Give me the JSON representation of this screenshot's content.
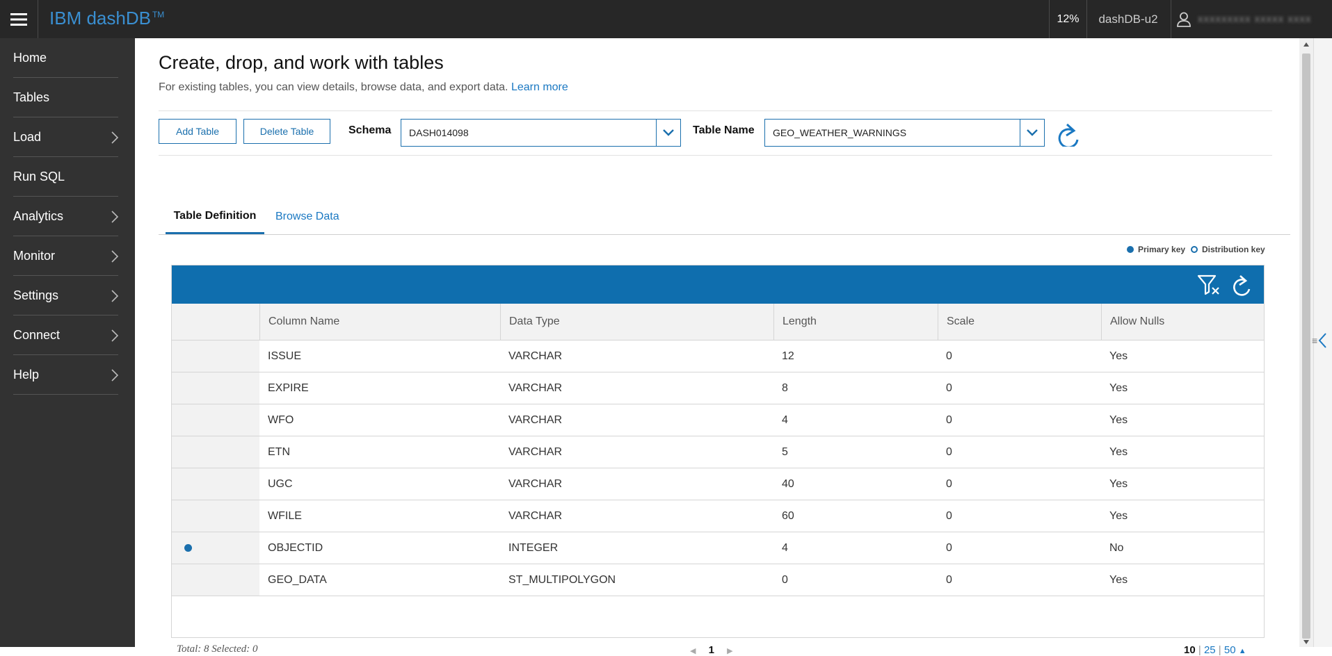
{
  "app": {
    "brand": "IBM dashDB",
    "brand_tm": "TM",
    "usage": "12%",
    "instance": "dashDB-u2",
    "user_name": "xxxxxxxxx xxxxx xxxx"
  },
  "sidebar": {
    "items": [
      {
        "label": "Home",
        "has_submenu": false
      },
      {
        "label": "Tables",
        "has_submenu": false
      },
      {
        "label": "Load",
        "has_submenu": true
      },
      {
        "label": "Run SQL",
        "has_submenu": false
      },
      {
        "label": "Analytics",
        "has_submenu": true
      },
      {
        "label": "Monitor",
        "has_submenu": true
      },
      {
        "label": "Settings",
        "has_submenu": true
      },
      {
        "label": "Connect",
        "has_submenu": true
      },
      {
        "label": "Help",
        "has_submenu": true
      }
    ]
  },
  "page": {
    "title": "Create, drop, and work with tables",
    "subtitle": "For existing tables, you can view details, browse data, and export data.",
    "learn_more": "Learn more"
  },
  "toolbar": {
    "add_table": "Add Table",
    "delete_table": "Delete Table",
    "schema_label": "Schema",
    "schema_value": "DASH014098",
    "table_name_label": "Table Name",
    "table_name_value": "GEO_WEATHER_WARNINGS"
  },
  "tabs": [
    {
      "label": "Table Definition",
      "active": true
    },
    {
      "label": "Browse Data",
      "active": false
    }
  ],
  "legend": {
    "primary_key": "Primary key",
    "distribution_key": "Distribution key"
  },
  "grid": {
    "columns": [
      "Column Name",
      "Data Type",
      "Length",
      "Scale",
      "Allow Nulls"
    ],
    "rows": [
      {
        "primary": false,
        "name": "ISSUE",
        "type": "VARCHAR",
        "length": "12",
        "scale": "0",
        "nulls": "Yes"
      },
      {
        "primary": false,
        "name": "EXPIRE",
        "type": "VARCHAR",
        "length": "8",
        "scale": "0",
        "nulls": "Yes"
      },
      {
        "primary": false,
        "name": "WFO",
        "type": "VARCHAR",
        "length": "4",
        "scale": "0",
        "nulls": "Yes"
      },
      {
        "primary": false,
        "name": "ETN",
        "type": "VARCHAR",
        "length": "5",
        "scale": "0",
        "nulls": "Yes"
      },
      {
        "primary": false,
        "name": "UGC",
        "type": "VARCHAR",
        "length": "40",
        "scale": "0",
        "nulls": "Yes"
      },
      {
        "primary": false,
        "name": "WFILE",
        "type": "VARCHAR",
        "length": "60",
        "scale": "0",
        "nulls": "Yes"
      },
      {
        "primary": true,
        "name": "OBJECTID",
        "type": "INTEGER",
        "length": "4",
        "scale": "0",
        "nulls": "No"
      },
      {
        "primary": false,
        "name": "GEO_DATA",
        "type": "ST_MULTIPOLYGON",
        "length": "0",
        "scale": "0",
        "nulls": "Yes"
      }
    ],
    "footer_total": "Total: 8 Selected: 0",
    "current_page": "1",
    "page_sizes": [
      "10",
      "25",
      "50"
    ],
    "active_page_size": "10"
  },
  "colors": {
    "accent": "#0f6eae",
    "link": "#1a78c2",
    "topbar": "#272727",
    "sidebar": "#323232"
  },
  "icons": {
    "menu": "hamburger-icon",
    "user": "user-icon",
    "dropdown": "chevron-down-icon",
    "refresh": "refresh-icon",
    "filter": "filter-icon",
    "submenu": "chevron-right-icon",
    "panel_toggle": "chevron-left-icon"
  }
}
